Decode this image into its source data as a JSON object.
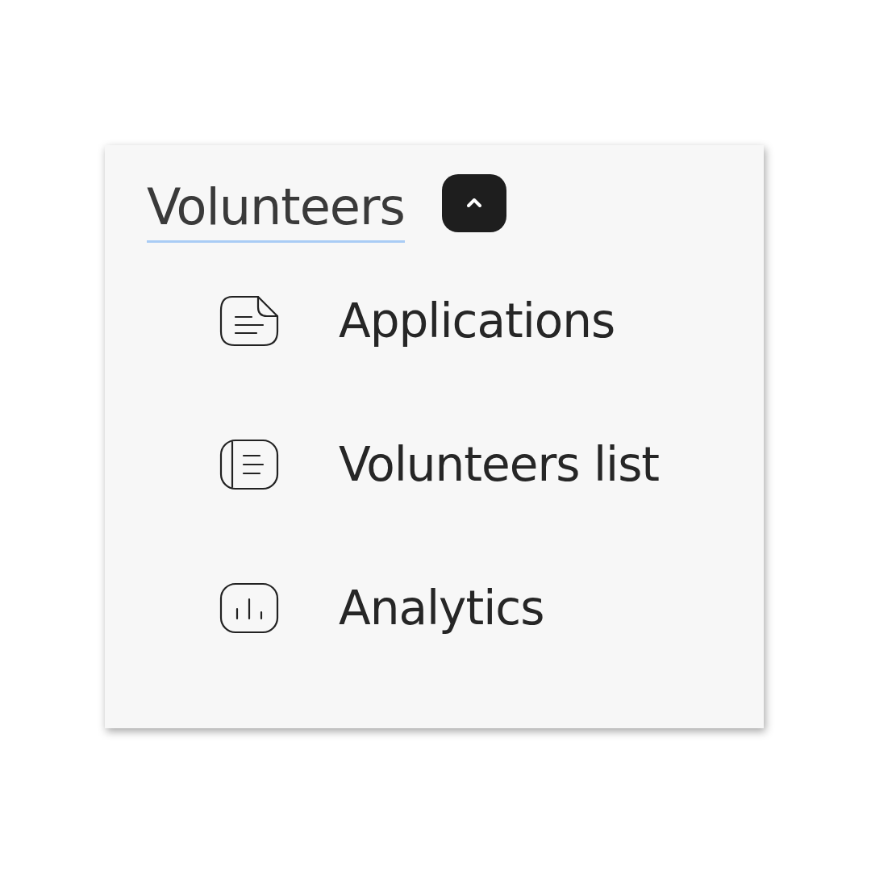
{
  "section": {
    "title": "Volunteers",
    "expanded": true,
    "items": [
      {
        "label": "Applications",
        "kind": "document"
      },
      {
        "label": "Volunteers list",
        "kind": "list"
      },
      {
        "label": "Analytics",
        "kind": "chart"
      }
    ]
  }
}
